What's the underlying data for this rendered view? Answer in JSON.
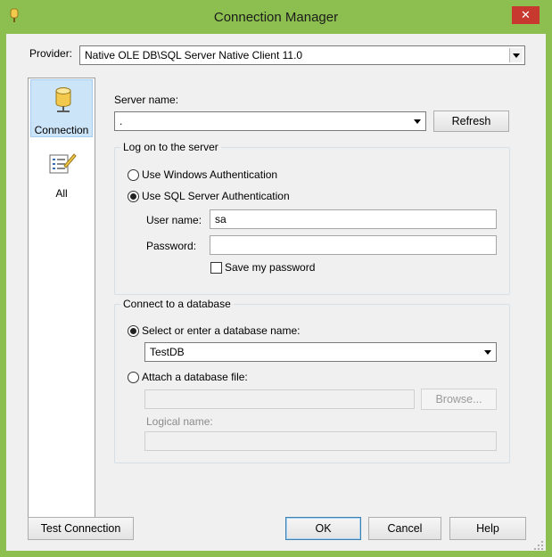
{
  "window": {
    "title": "Connection Manager",
    "close_glyph": "✕"
  },
  "provider": {
    "label": "Provider:",
    "value": "Native OLE DB\\SQL Server Native Client 11.0"
  },
  "sidebar": {
    "items": [
      {
        "label": "Connection",
        "icon": "database-cylinder-icon",
        "selected": true
      },
      {
        "label": "All",
        "icon": "properties-list-icon",
        "selected": false
      }
    ]
  },
  "server": {
    "label": "Server name:",
    "value": ".",
    "refresh_label": "Refresh"
  },
  "logon": {
    "legend": "Log on to the server",
    "windows_auth_label": "Use Windows Authentication",
    "sql_auth_label": "Use SQL Server Authentication",
    "selected": "sql",
    "username_label": "User name:",
    "username_value": "sa",
    "password_label": "Password:",
    "password_value": "",
    "save_password_label": "Save my password",
    "save_password_checked": false
  },
  "database": {
    "legend": "Connect to a database",
    "select_label": "Select or enter a database name:",
    "select_value": "TestDB",
    "attach_label": "Attach a database file:",
    "attach_value": "",
    "browse_label": "Browse...",
    "logical_label": "Logical name:",
    "logical_value": "",
    "selected": "select"
  },
  "footer": {
    "test_label": "Test Connection",
    "ok_label": "OK",
    "cancel_label": "Cancel",
    "help_label": "Help"
  },
  "colors": {
    "frame": "#8cbf4f",
    "dialog": "#f0f0f0",
    "selection": "#cce4f7",
    "close": "#c7392e"
  }
}
